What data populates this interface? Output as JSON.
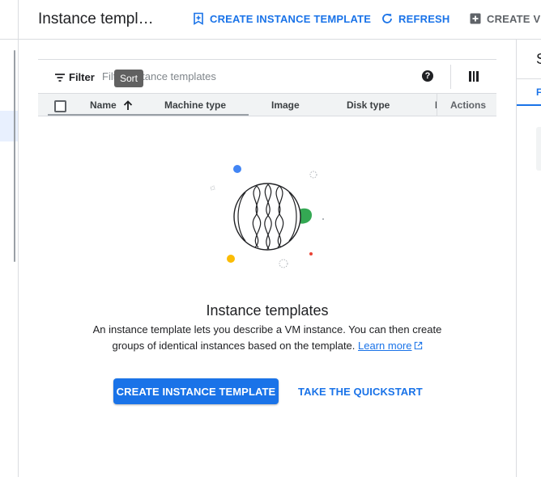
{
  "header": {
    "title": "Instance templ…",
    "create_template_label": "CREATE INSTANCE TEMPLATE",
    "refresh_label": "REFRESH",
    "create_vm_label": "CREATE VM"
  },
  "filter": {
    "label": "Filter",
    "placeholder": "Filter instance templates",
    "help_glyph": "?"
  },
  "tooltip": {
    "text": "Sort"
  },
  "table": {
    "columns": [
      "Name",
      "Machine type",
      "Image",
      "Disk type",
      "I",
      "Actions"
    ],
    "sort": {
      "column": "Name",
      "direction": "ascending"
    }
  },
  "empty_state": {
    "title": "Instance templates",
    "description": "An instance template lets you describe a VM instance. You can then create groups of identical instances based on the template.",
    "learn_more": "Learn more",
    "primary_button": "CREATE INSTANCE TEMPLATE",
    "secondary_button": "TAKE THE QUICKSTART"
  },
  "right_panel": {
    "title": "S",
    "tab": "F"
  },
  "colors": {
    "accent": "#1a73e8",
    "illustration": [
      "#4285f4",
      "#34a853",
      "#fbbc04",
      "#ea4335"
    ]
  }
}
